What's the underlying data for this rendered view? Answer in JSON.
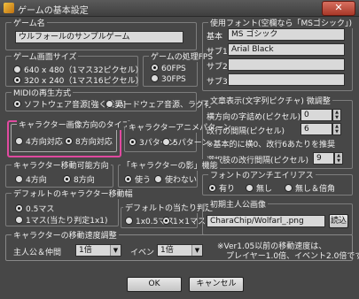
{
  "window": {
    "title": "ゲームの基本設定",
    "close": "✕"
  },
  "game_name": {
    "label": "ゲーム名",
    "value": "ウルフォールのサンプルゲーム"
  },
  "screen_size": {
    "label": "ゲーム画面サイズ",
    "options": [
      "640 x 480（1マス32ピクセル）",
      "320 x 240（1マス16ピクセル）"
    ],
    "selected": 1
  },
  "fps": {
    "label": "ゲームの処理FPS",
    "options": [
      "60FPS",
      "30FPS"
    ],
    "selected": 0
  },
  "midi": {
    "label": "MIDIの再生方式",
    "options": [
      "ソフトウェア音源[強く推奨]",
      "ハードウェア音源、ラグ有"
    ],
    "selected": 0
  },
  "fonts": {
    "label": "使用フォント(空欄なら「MSゴシック」)",
    "rows": [
      {
        "label": "基本",
        "value": "MS ゴシック"
      },
      {
        "label": "サブ1",
        "value": "Arial Black"
      },
      {
        "label": "サブ2",
        "value": ""
      },
      {
        "label": "サブ3",
        "value": ""
      }
    ]
  },
  "char_dir": {
    "label": "キャラクター画像方向のタイプ",
    "options": [
      "4方向対応",
      "8方向対応"
    ],
    "selected": 1
  },
  "char_anim": {
    "label": "キャラクターアニメパターン",
    "options": [
      "3パターン",
      "5パターン"
    ],
    "selected": 0
  },
  "text_display": {
    "label": "文章表示(文字列ピクチャ) 微調整",
    "row1_label": "横方向の字詰め(ピクセル)",
    "row1_value": "0",
    "row2_label": "改行の間隔(ピクセル)",
    "row2_value": "6",
    "note": "※基本的に横0、改行6あたりを推奨",
    "row3_label": "選択肢の改行間隔(ピクセル)",
    "row3_value": "9"
  },
  "move_dir": {
    "label": "キャラクター移動可能方向",
    "options": [
      "4方向",
      "8方向"
    ],
    "selected": 1
  },
  "shadow": {
    "label": "「キャラクターの影」機能",
    "options": [
      "使う",
      "使わない"
    ],
    "selected": 0
  },
  "antialias": {
    "label": "フォントのアンチエイリアス",
    "options": [
      "有り",
      "無し",
      "無し＆倍角"
    ],
    "selected": 0
  },
  "default_move": {
    "label": "デフォルトのキャラクター移動幅",
    "options": [
      "0.5マス",
      "1マス(当たり判定1x1)"
    ],
    "selected": 0
  },
  "default_hit": {
    "label": "デフォルトの当たり判定",
    "options": [
      "1x0.5マス",
      "1×1マス"
    ],
    "selected": 1
  },
  "hero_image": {
    "label": "初期主人公画像",
    "value": "CharaChip/Wolfarl_.png",
    "button": "読込"
  },
  "speed": {
    "label": "キャラクターの移動速度調整",
    "party_label": "主人公＆仲間",
    "party_value": "1倍",
    "event_label": "イベント",
    "event_value": "1倍",
    "note1": "※Ver1.05以前の移動速度は、",
    "note2": "プレイヤー1.0倍、イベント2.0倍です"
  },
  "buttons": {
    "ok": "OK",
    "cancel": "キャンセル"
  }
}
